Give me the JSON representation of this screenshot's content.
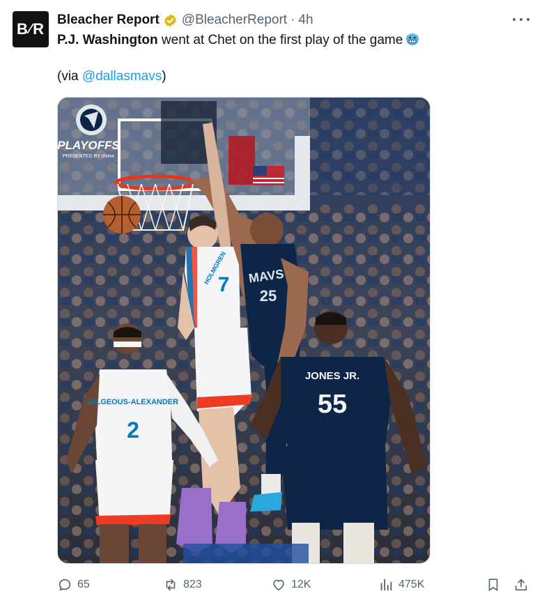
{
  "author": {
    "avatar_text_left": "B",
    "avatar_text_right": "R",
    "name": "Bleacher Report",
    "handle": "@BleacherReport",
    "separator": "·",
    "time": "4h",
    "verified_icon": "gold-verified-badge-icon"
  },
  "tweet": {
    "bold_name": "P.J. Washington",
    "text_rest": " went at Chet on the first play of the game",
    "emoji": "cold-face-emoji",
    "via_prefix": "(via ",
    "via_link": "@dallasmavs",
    "via_suffix": ")"
  },
  "media": {
    "logo_text": "PLAYOFFS",
    "logo_sub": "PRESENTED BY chime",
    "jersey_front_number": "7",
    "jersey_front_name": "HOLMGREN",
    "jersey_defender_text": "MAVS",
    "jersey_defender_number": "25",
    "jersey_back_left_name": "GILGEOUS-ALEXANDER",
    "jersey_back_left_number": "2",
    "jersey_back_right_name": "JONES JR.",
    "jersey_back_right_number": "55"
  },
  "actions": {
    "replies": "65",
    "reposts": "823",
    "likes": "12K",
    "views": "475K"
  },
  "colors": {
    "accent": "#1d9bf0",
    "secondary_text": "#536471",
    "thunder_orange": "#ef3b24",
    "thunder_blue": "#007ac1",
    "mavs_navy": "#0d2647"
  }
}
